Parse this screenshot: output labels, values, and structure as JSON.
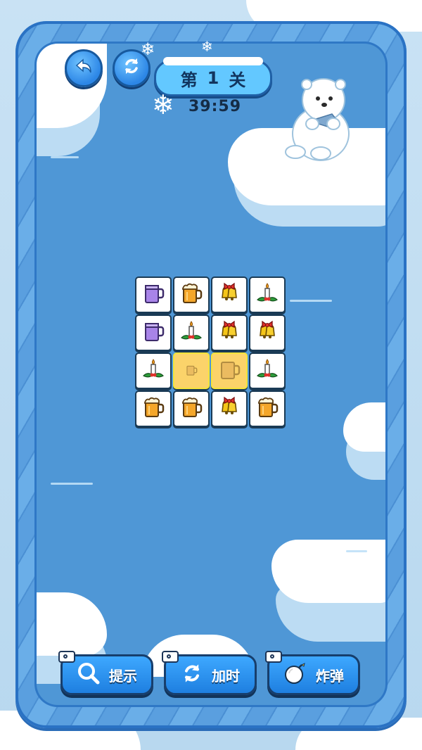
{
  "header": {
    "level_prefix": "第",
    "level_number": "1",
    "level_suffix": "关",
    "timer": "39:59",
    "back_icon": "back-arrow-icon",
    "restart_icon": "refresh-icon"
  },
  "board": {
    "rows": [
      [
        "purple-mug",
        "beer-mug",
        "christmas-bells",
        "christmas-candle"
      ],
      [
        "purple-mug",
        "christmas-candle",
        "christmas-bells",
        "christmas-bells"
      ],
      [
        "christmas-candle",
        "beer-mug-selected",
        "beer-mug-selected",
        "christmas-candle"
      ],
      [
        "beer-mug",
        "beer-mug",
        "christmas-bells",
        "beer-mug"
      ]
    ],
    "selected_tiles": [
      "row3-col2",
      "row3-col3"
    ]
  },
  "actions": {
    "hint_label": "提示",
    "add_time_label": "加时",
    "bomb_label": "炸弹"
  },
  "colors": {
    "water": "#4f97d6",
    "frame": "#4a8fd3",
    "button": "#1e7fe0",
    "selected_tile": "#fbd36a"
  }
}
